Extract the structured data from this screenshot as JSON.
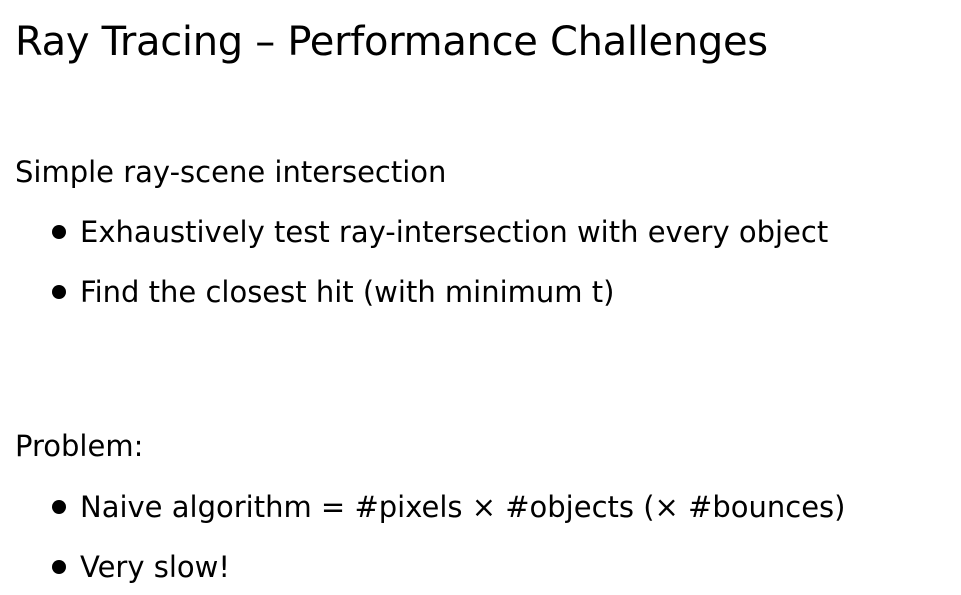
{
  "slide": {
    "title": "Ray Tracing – Performance Challenges",
    "sections": [
      {
        "heading": "Simple ray-scene intersection",
        "bullets": [
          "Exhaustively test ray-intersection with every object",
          "Find the closest hit (with minimum t)"
        ]
      },
      {
        "heading": "Problem:",
        "bullets": [
          "Naive algorithm = #pixels × #objects (× #bounces)",
          "Very slow!"
        ]
      }
    ]
  }
}
